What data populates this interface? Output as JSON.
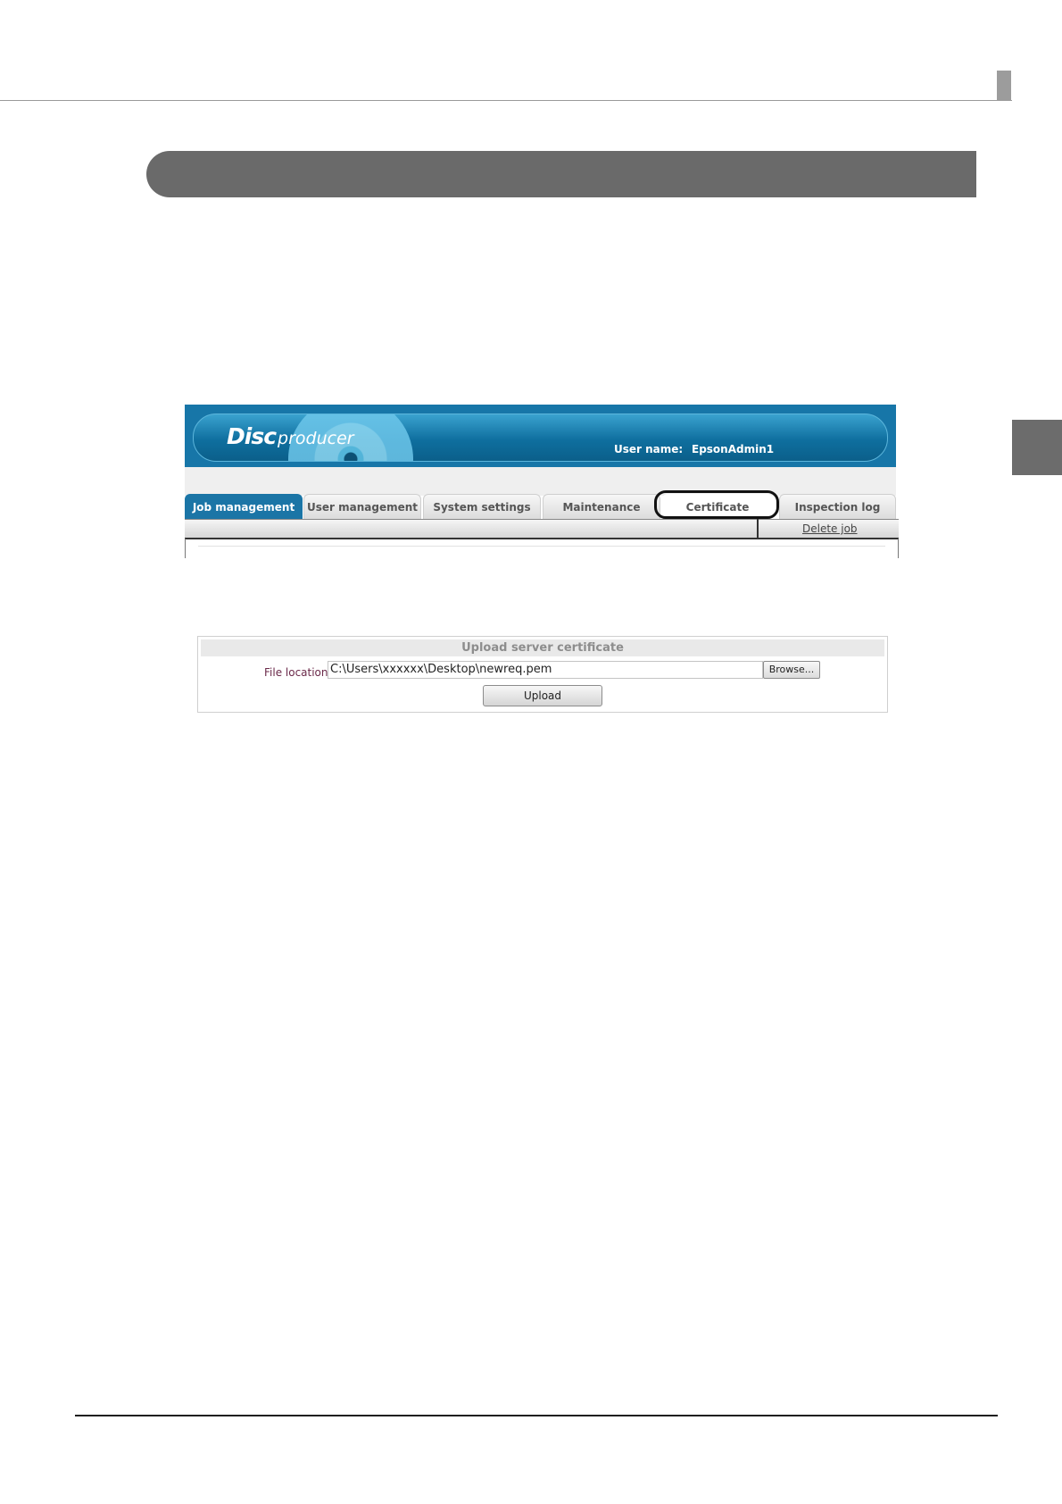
{
  "header": {
    "logo_disc": "Disc",
    "logo_producer": "producer",
    "user_label": "User name:",
    "user_value": "EpsonAdmin1"
  },
  "tabs": [
    {
      "label": "Job management",
      "active": true
    },
    {
      "label": "User management",
      "active": false
    },
    {
      "label": "System settings",
      "active": false
    },
    {
      "label": "Maintenance",
      "active": false
    },
    {
      "label": "Certificate",
      "active": false,
      "highlighted": true
    },
    {
      "label": "Inspection log",
      "active": false
    }
  ],
  "subbar": {
    "delete_link": "Delete job"
  },
  "upload": {
    "title": "Upload server certificate",
    "file_label": "File location",
    "file_value": "C:\\Users\\xxxxxx\\Desktop\\newreq.pem",
    "browse_label": "Browse...",
    "upload_label": "Upload"
  },
  "colors": {
    "banner": "#1776a8",
    "active_tab": "#1b75a6",
    "section_bar": "#6a6a6a"
  }
}
